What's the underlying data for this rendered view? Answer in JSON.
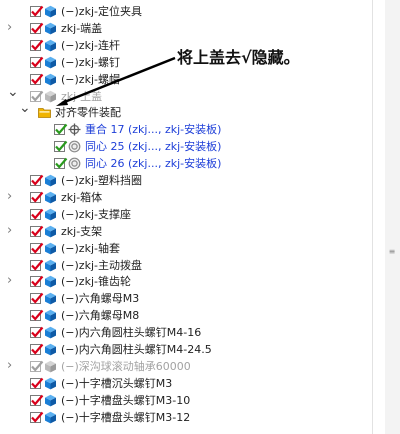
{
  "annotation": {
    "text": "将上盖去√隐藏。"
  },
  "tree": {
    "items": [
      {
        "label": "(−)zkj-定位夹具",
        "checked": true,
        "state": "normal",
        "icon": "part-icon",
        "expand": "none",
        "indent": 0
      },
      {
        "label": "zkj-端盖",
        "checked": true,
        "state": "normal",
        "icon": "part-icon",
        "expand": "collapsed",
        "indent": 0
      },
      {
        "label": "(−)zkj-连杆",
        "checked": true,
        "state": "normal",
        "icon": "part-icon",
        "expand": "none",
        "indent": 0
      },
      {
        "label": "(−)zkj-螺钉",
        "checked": true,
        "state": "normal",
        "icon": "part-icon",
        "expand": "none",
        "indent": 0
      },
      {
        "label": "(−)zkj-螺帽",
        "checked": true,
        "state": "normal",
        "icon": "part-icon",
        "expand": "none",
        "indent": 0
      },
      {
        "label": "zkj-上盖",
        "checked": true,
        "state": "hidden",
        "icon": "part-icon",
        "expand": "expanded",
        "indent": 0
      },
      {
        "label": "对齐零件装配",
        "checked": null,
        "state": "normal",
        "icon": "folder-icon",
        "expand": "expanded",
        "indent": 1
      },
      {
        "label": "重合 17 (zkj..., zkj-安装板)",
        "checked": true,
        "state": "mate",
        "icon": "coincident-icon",
        "expand": "none",
        "indent": 2
      },
      {
        "label": "同心 25 (zkj..., zkj-安装板)",
        "checked": true,
        "state": "mate",
        "icon": "concentric-icon",
        "expand": "none",
        "indent": 2
      },
      {
        "label": "同心 26 (zkj..., zkj-安装板)",
        "checked": true,
        "state": "mate",
        "icon": "concentric-icon",
        "expand": "none",
        "indent": 2
      },
      {
        "label": "(−)zkj-塑料挡圈",
        "checked": true,
        "state": "normal",
        "icon": "part-icon",
        "expand": "none",
        "indent": 0
      },
      {
        "label": "zkj-箱体",
        "checked": true,
        "state": "normal",
        "icon": "part-icon",
        "expand": "collapsed",
        "indent": 0
      },
      {
        "label": "(−)zkj-支撑座",
        "checked": true,
        "state": "normal",
        "icon": "part-icon",
        "expand": "none",
        "indent": 0
      },
      {
        "label": "zkj-支架",
        "checked": true,
        "state": "normal",
        "icon": "part-icon",
        "expand": "collapsed",
        "indent": 0
      },
      {
        "label": "(−)zkj-轴套",
        "checked": true,
        "state": "normal",
        "icon": "part-icon",
        "expand": "none",
        "indent": 0
      },
      {
        "label": "(−)zkj-主动拨盘",
        "checked": true,
        "state": "normal",
        "icon": "part-icon",
        "expand": "none",
        "indent": 0
      },
      {
        "label": "(−)zkj-锥齿轮",
        "checked": true,
        "state": "normal",
        "icon": "part-icon",
        "expand": "collapsed",
        "indent": 0
      },
      {
        "label": "(−)六角螺母M3",
        "checked": true,
        "state": "normal",
        "icon": "part-icon",
        "expand": "none",
        "indent": 0
      },
      {
        "label": "(−)六角螺母M8",
        "checked": true,
        "state": "normal",
        "icon": "part-icon",
        "expand": "none",
        "indent": 0
      },
      {
        "label": "(−)内六角圆柱头螺钉M4-16",
        "checked": true,
        "state": "normal",
        "icon": "part-icon",
        "expand": "none",
        "indent": 0
      },
      {
        "label": "(−)内六角圆柱头螺钉M4-24.5",
        "checked": true,
        "state": "normal",
        "icon": "part-icon",
        "expand": "none",
        "indent": 0
      },
      {
        "label": "(−)深沟球滚动轴承60000",
        "checked": true,
        "state": "hidden",
        "icon": "part-icon",
        "expand": "collapsed",
        "indent": 0
      },
      {
        "label": "(−)十字槽沉头螺钉M3",
        "checked": true,
        "state": "normal",
        "icon": "part-icon",
        "expand": "none",
        "indent": 0
      },
      {
        "label": "(−)十字槽盘头螺钉M3-10",
        "checked": true,
        "state": "normal",
        "icon": "part-icon",
        "expand": "none",
        "indent": 0
      },
      {
        "label": "(−)十字槽盘头螺钉M3-12",
        "checked": true,
        "state": "normal",
        "icon": "part-icon",
        "expand": "none",
        "indent": 0
      }
    ]
  },
  "colors": {
    "check_normal": "#d9001b",
    "check_hidden": "#a0a0a0",
    "check_mate": "#2a9a1e",
    "part_blue": "#1a7fd6",
    "mate_text": "#1e3fd8",
    "folder": "#f0b400"
  }
}
